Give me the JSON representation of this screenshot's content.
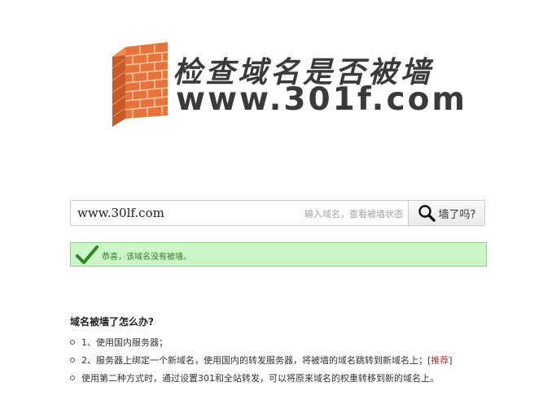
{
  "logo": {
    "title": "检查域名是否被墙",
    "domain": "www.301f.com",
    "wall_color": "#e8733a"
  },
  "search": {
    "value": "www.30lf.com",
    "placeholder": "输入域名，查看被墙状态",
    "button_label": "墙了吗?",
    "button_icon": "magnifier-icon"
  },
  "result": {
    "icon": "checkmark-icon",
    "message": "恭喜，该域名没有被墙。",
    "background": "#ccf5c8"
  },
  "faq": {
    "title": "域名被墙了怎么办?",
    "items": [
      {
        "text": "1、使用国内服务器；"
      },
      {
        "text": "2、服务器上绑定一个新域名，使用国内的转发服务器，将被墙的域名跳转到新域名上；",
        "bracket_open": "[",
        "link": "推荐",
        "bracket_close": "]"
      },
      {
        "text": "使用第二种方式时，通过设置301和全站转发，可以将原来域名的权重转移到新的域名上。"
      }
    ],
    "link_color": "#c9302c"
  }
}
